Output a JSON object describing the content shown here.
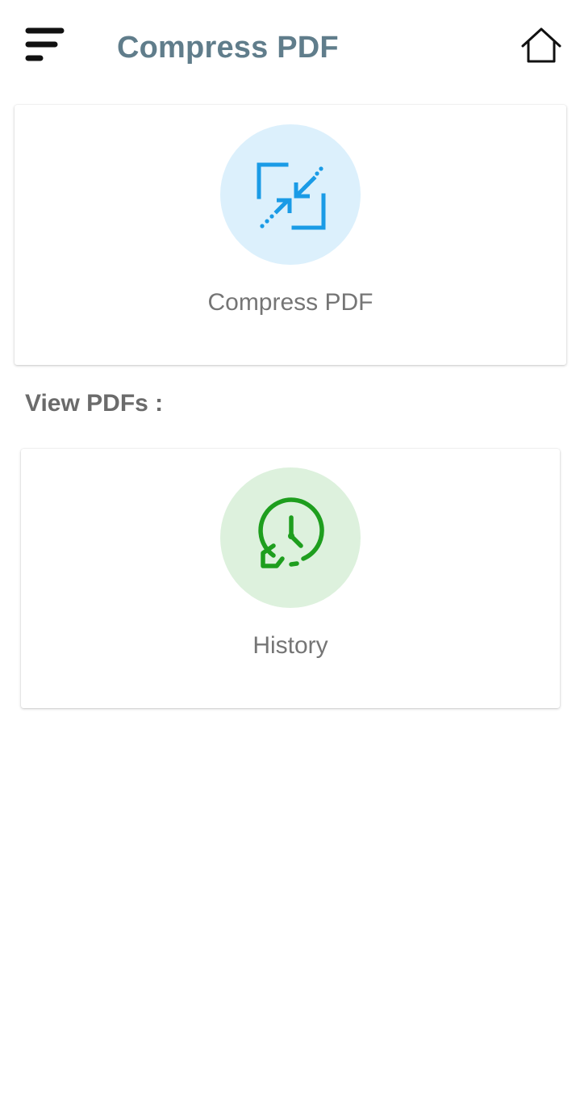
{
  "header": {
    "title": "Compress PDF",
    "menu_icon": "menu-icon",
    "home_icon": "home-icon"
  },
  "compress_card": {
    "label": "Compress PDF",
    "icon": "compress-icon",
    "icon_color": "#1a9be6",
    "circle_color": "#dcf0fc"
  },
  "view_section": {
    "label": "View PDFs :"
  },
  "history_card": {
    "label": "History",
    "icon": "history-icon",
    "icon_color": "#1e9e1e",
    "circle_color": "#ddf1dd"
  },
  "colors": {
    "title": "#607d8b",
    "label": "#757575",
    "background": "#ffffff"
  }
}
